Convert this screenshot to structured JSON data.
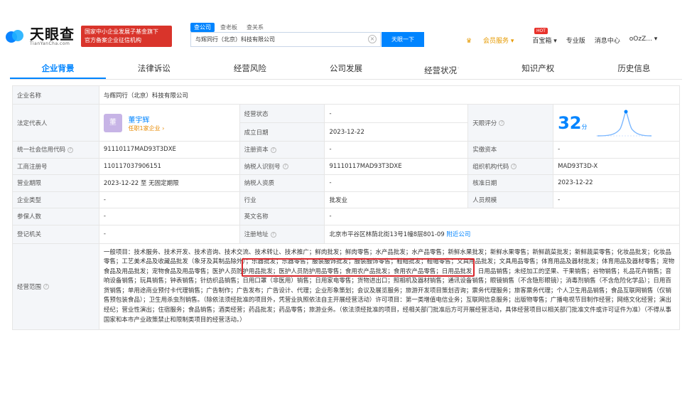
{
  "header": {
    "logo_title": "天眼查",
    "logo_sub": "TianYanCha.com",
    "red_tag_line1": "国家中小企业发展子基金旗下",
    "red_tag_line2": "官方备案企业征信机构",
    "search_tabs": [
      "查公司",
      "查老板",
      "查关系"
    ],
    "search_value": "与辉同行（北京）科技有限公司",
    "search_button": "天眼一下",
    "nav": {
      "vip": "会员服务 ▾",
      "baibao": "百宝箱 ▾",
      "pro": "专业版",
      "msg": "消息中心",
      "user": "oOzZ... ▾"
    },
    "hot_badge": "HOT"
  },
  "tabs": [
    "企业背景",
    "法律诉讼",
    "经营风险",
    "公司发展",
    "经营状况",
    "知识产权",
    "历史信息"
  ],
  "company": {
    "name_label": "企业名称",
    "name": "与辉同行（北京）科技有限公司",
    "legal_label": "法定代表人",
    "legal_avatar": "董",
    "legal_name": "董宇辉",
    "legal_sub": "任职1家企业 ›",
    "status_label": "经营状态",
    "status": "-",
    "found_label": "成立日期",
    "found": "2023-12-22",
    "score_label": "天眼评分",
    "score": "32",
    "score_unit": "分",
    "credit_label": "统一社会信用代码",
    "credit": "91110117MAD93T3DXE",
    "capital_label": "注册资本",
    "capital": "-",
    "paid_label": "实缴资本",
    "paid": "-",
    "reg_no_label": "工商注册号",
    "reg_no": "110117037906151",
    "tax_label": "纳税人识别号",
    "tax": "91110117MAD93T3DXE",
    "org_label": "组织机构代码",
    "org": "MAD93T3D-X",
    "term_label": "营业期限",
    "term": "2023-12-22 至 无固定期限",
    "taxq_label": "纳税人资质",
    "taxq": "-",
    "approve_label": "核准日期",
    "approve": "2023-12-22",
    "type_label": "企业类型",
    "type": "-",
    "industry_label": "行业",
    "industry": "批发业",
    "staff_label": "人员规模",
    "staff": "-",
    "insured_label": "参保人数",
    "insured": "-",
    "en_label": "英文名称",
    "en": "-",
    "authority_label": "登记机关",
    "authority": "-",
    "addr_label": "注册地址",
    "addr": "北京市平谷区林荫北街13号1幢8层801-09",
    "nearby": "附近公司",
    "scope_label": "经营范围",
    "scope": "一般项目：技术服务、技术开发、技术咨询、技术交流、技术转让、技术推广；鲜肉批发；鲜肉零售；水产品批发；水产品零售；新鲜水果批发；新鲜水果零售；新鲜蔬菜批发；新鲜蔬菜零售；化妆品批发；化妆品零售；工艺美术品及收藏品批发（象牙及其制品除外）；乐器批发；乐器零售；服装服饰批发；服装服饰零售；鞋帽批发；鞋帽零售；文具用品批发；文具用品零售；体育用品及器材批发；体育用品及器材零售；宠物食品及用品批发；宠物食品及用品零售；医护人员防护用品批发；医护人员防护用品零售；食用农产品批发；食用农产品零售；日用品批发；日用品销售；未经加工的坚果、干果销售；谷物销售；礼品花卉销售；音响设备销售；玩具销售；钟表销售；针纺织品销售；日用口罩（非医用）销售；日用家电零售；货物进出口；照相机及器材销售；通讯设备销售；眼镜销售（不含隐形眼镜）；消毒剂销售（不含危险化学品）；日用百货销售；单用途商业预付卡代理销售；广告制作；广告发布；广告设计、代理；企业形象策划；会议及展览服务；旅游开发项目策划咨询；票务代理服务；旅客票务代理；个人卫生用品销售；食品互联网销售（仅销售预包装食品）；卫生用杀虫剂销售。（除依法须经批准的项目外，凭营业执照依法自主开展经营活动）许可项目：第一类增值电信业务；互联网信息服务；出版物零售；广播电视节目制作经营；网络文化经营；演出经纪；营业性演出；住宿服务；食品销售；酒类经营；药品批发；药品零售；旅游业务。（依法须经批准的项目，经相关部门批准后方可开展经营活动，具体经营项目以相关部门批准文件或许可证件为准）（不得从事国家和本市产业政策禁止和限制类项目的经营活动。）"
  },
  "colors": {
    "accent": "#0084ff",
    "red": "#d9262b",
    "label_bg": "#f4f6f9"
  }
}
